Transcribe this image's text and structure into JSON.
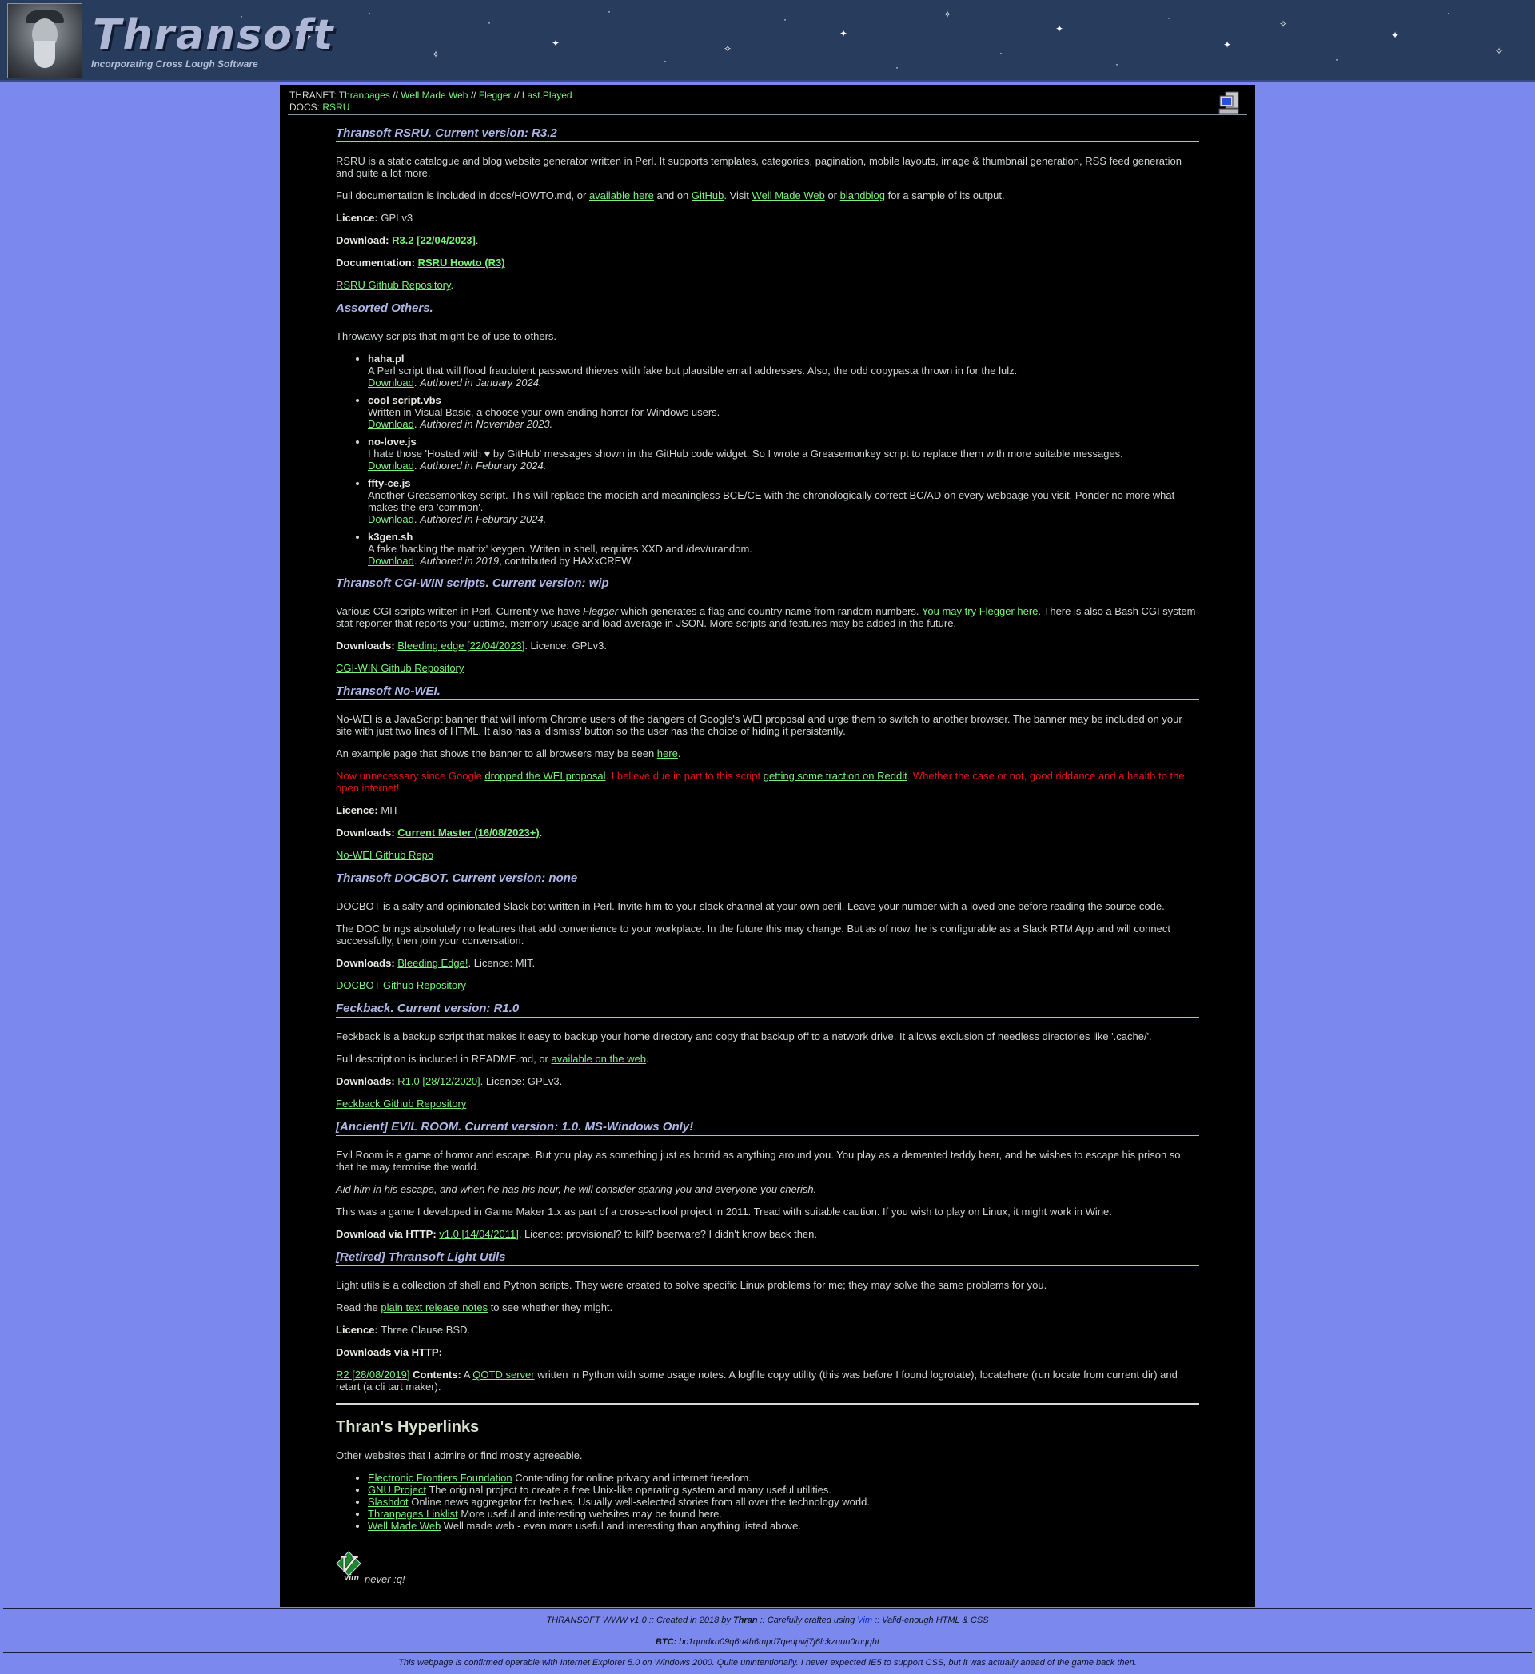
{
  "site": {
    "logo": "Thransoft",
    "tagline": "Incorporating Cross Lough Software"
  },
  "nav": {
    "thranet_label": "THRANET:",
    "thranet_links": [
      "Thranpages",
      "Well Made Web",
      "Flegger",
      "Last.Played"
    ],
    "docs_label": "DOCS:",
    "docs_link": "RSRU",
    "separator": "//"
  },
  "rsru": {
    "heading": "Thransoft RSRU. Current version: R3.2",
    "p1": "RSRU is a static catalogue and blog website generator written in Perl. It supports templates, categories, pagination, mobile layouts, image & thumbnail generation, RSS feed generation and quite a lot more.",
    "p2_a": "Full documentation is included in docs/HOWTO.md, or ",
    "p2_link1": "available here",
    "p2_b": " and on ",
    "p2_link2": "GitHub",
    "p2_c": ". Visit ",
    "p2_link3": "Well Made Web",
    "p2_d": " or ",
    "p2_link4": "blandblog",
    "p2_e": " for a sample of its output.",
    "licence_label": "Licence:",
    "licence": " GPLv3",
    "download_label": "Download:",
    "download_link": "R3.2 [22/04/2023]",
    "documentation_label": "Documentation:",
    "documentation_link": "RSRU Howto (R3)",
    "repo_link": "RSRU Github Repository"
  },
  "assorted": {
    "heading": "Assorted Others.",
    "intro": "Throwawy scripts that might be of use to others.",
    "download_label": "Download",
    "items": [
      {
        "name": "haha.pl",
        "desc": "A Perl script that will flood fraudulent password thieves with fake but plausible email addresses. Also, the odd copypasta thrown in for the lulz.",
        "authored": "Authored in January 2024.",
        "extra": ""
      },
      {
        "name": "cool script.vbs",
        "desc": "Written in Visual Basic, a choose your own ending horror for Windows users.",
        "authored": "Authored in November 2023.",
        "extra": ""
      },
      {
        "name": "no-love.js",
        "desc": "I hate those 'Hosted with ♥ by GitHub' messages shown in the GitHub code widget. So I wrote a Greasemonkey script to replace them with more suitable messages.",
        "authored": "Authored in Feburary 2024.",
        "extra": ""
      },
      {
        "name": "ffty-ce.js",
        "desc": "Another Greasemonkey script. This will replace the modish and meaningless BCE/CE with the chronologically correct BC/AD on every webpage you visit. Ponder no more what makes the era 'common'.",
        "authored": "Authored in Feburary 2024.",
        "extra": ""
      },
      {
        "name": "k3gen.sh",
        "desc": "A fake 'hacking the matrix' keygen. Writen in shell, requires XXD and /dev/urandom.",
        "authored": "Authored in 2019",
        "extra": ", contributed by HAXxCREW."
      }
    ]
  },
  "cgiwin": {
    "heading": "Thransoft CGI-WIN scripts. Current version: wip",
    "p1_a": "Various CGI scripts written in Perl. Currently we have ",
    "p1_em": "Flegger",
    "p1_b": " which generates a flag and country name from random numbers. ",
    "p1_link": "You may try Flegger here",
    "p1_c": ". There is also a Bash CGI system stat reporter that reports your uptime, memory usage and load average in JSON. More scripts and features may be added in the future.",
    "downloads_label": "Downloads:",
    "downloads_link": "Bleeding edge [22/04/2023]",
    "downloads_tail": ". Licence: GPLv3.",
    "repo_link": "CGI-WIN Github Repository"
  },
  "nowei": {
    "heading": "Thransoft No-WEI.",
    "p1": "No-WEI is a JavaScript banner that will inform Chrome users of the dangers of Google's WEI proposal and urge them to switch to another browser. The banner may be included on your site with just two lines of HTML. It also has a 'dismiss' button so the user has the choice of hiding it persistently.",
    "p2_a": "An example page that shows the banner to all browsers may be seen ",
    "p2_link": "here",
    "p2_b": ".",
    "red_a": "Now unnecessary since Google ",
    "red_link1": "dropped the WEI proposal",
    "red_b": ". I believe due in part to this script ",
    "red_link2": "getting some traction on Reddit",
    "red_c": ". Whether the case or not, good riddance and a health to the open internet!",
    "licence_label": "Licence:",
    "licence": " MIT",
    "downloads_label": "Downloads:",
    "downloads_link": "Current Master (16/08/2023+)",
    "repo_link": "No-WEI Github Repo"
  },
  "docbot": {
    "heading": "Thransoft DOCBOT. Current version: none",
    "p1": "DOCBOT is a salty and opinionated Slack bot written in Perl. Invite him to your slack channel at your own peril. Leave your number with a loved one before reading the source code.",
    "p2": "The DOC brings absolutely no features that add convenience to your workplace. In the future this may change. But as of now, he is configurable as a Slack RTM App and will connect successfully, then join your conversation.",
    "downloads_label": "Downloads:",
    "downloads_link": "Bleeding Edge!",
    "downloads_tail": ". Licence: MIT.",
    "repo_link": "DOCBOT Github Repository"
  },
  "feckback": {
    "heading": "Feckback. Current version: R1.0",
    "p1": "Feckback is a backup script that makes it easy to backup your home directory and copy that backup off to a network drive. It allows exclusion of needless directories like '.cache/'.",
    "p2_a": "Full description is included in README.md, or ",
    "p2_link": "available on the web",
    "p2_b": ".",
    "downloads_label": "Downloads:",
    "downloads_link": "R1.0 [28/12/2020]",
    "downloads_tail": ". Licence: GPLv3.",
    "repo_link": "Feckback Github Repository"
  },
  "evilroom": {
    "heading": "[Ancient] EVIL ROOM. Current version: 1.0. MS-Windows Only!",
    "p1": "Evil Room is a game of horror and escape. But you play as something just as horrid as anything around you. You play as a demented teddy bear, and he wishes to escape his prison so that he may terrorise the world.",
    "p2": "Aid him in his escape, and when he has his hour, he will consider sparing you and everyone you cherish.",
    "p3": "This was a game I developed in Game Maker 1.x as part of a cross-school project in 2011. Tread with suitable caution. If you wish to play on Linux, it might work in Wine.",
    "download_label": "Download via HTTP:",
    "download_link": "v1.0 [14/04/2011]",
    "download_tail": ". Licence: provisional? to kill? beerware? I didn't know back then."
  },
  "lightutils": {
    "heading": "[Retired] Thransoft Light Utils",
    "p1": "Light utils is a collection of shell and Python scripts. They were created to solve specific Linux problems for me; they may solve the same problems for you.",
    "p2_a": "Read the ",
    "p2_link": "plain text release notes",
    "p2_b": " to see whether they might.",
    "licence_label": "Licence:",
    "licence": " Three Clause BSD.",
    "downloads_label": "Downloads via HTTP:",
    "r2_link": "R2 [28/08/2019]",
    "contents_label": "Contents:",
    "contents_a": " A ",
    "contents_link": "QOTD server",
    "contents_b": " written in Python with some usage notes. A logfile copy utility (this was before I found logrotate), locatehere (run locate from current dir) and retart (a cli tart maker)."
  },
  "hyperlinks": {
    "heading": "Thran's Hyperlinks",
    "intro": "Other websites that I admire or find mostly agreeable.",
    "items": [
      {
        "link": "Electronic Frontiers Foundation",
        "desc": " Contending for online privacy and internet freedom."
      },
      {
        "link": "GNU Project",
        "desc": " The original project to create a free Unix-like operating system and many useful utilities."
      },
      {
        "link": "Slashdot",
        "desc": " Online news aggregator for techies. Usually well-selected stories from all over the technology world."
      },
      {
        "link": "Thranpages Linklist",
        "desc": " More useful and interesting websites may be found here."
      },
      {
        "link": "Well Made Web",
        "desc": " Well made web - even more useful and interesting than anything listed above."
      }
    ]
  },
  "vim": {
    "logo": "vim",
    "text": "never :q!"
  },
  "footer": {
    "line1_a": "THRANSOFT WWW v1.0 :: Created in 2018 by ",
    "line1_author": "Thran",
    "line1_b": " :: Carefully crafted using ",
    "line1_link": "Vim",
    "line1_c": " :: Valid-enough HTML & CSS",
    "btc_label": "BTC:",
    "btc_address": " bc1qmdkn09q6u4h6mpd7qedpwj7j6lckzuun0mqqht",
    "note": "This webpage is confirmed operable with Internet Explorer 5.0 on Windows 2000. Quite unintentionally. I never expected IE5 to support CSS, but it was actually ahead of the game back then."
  }
}
